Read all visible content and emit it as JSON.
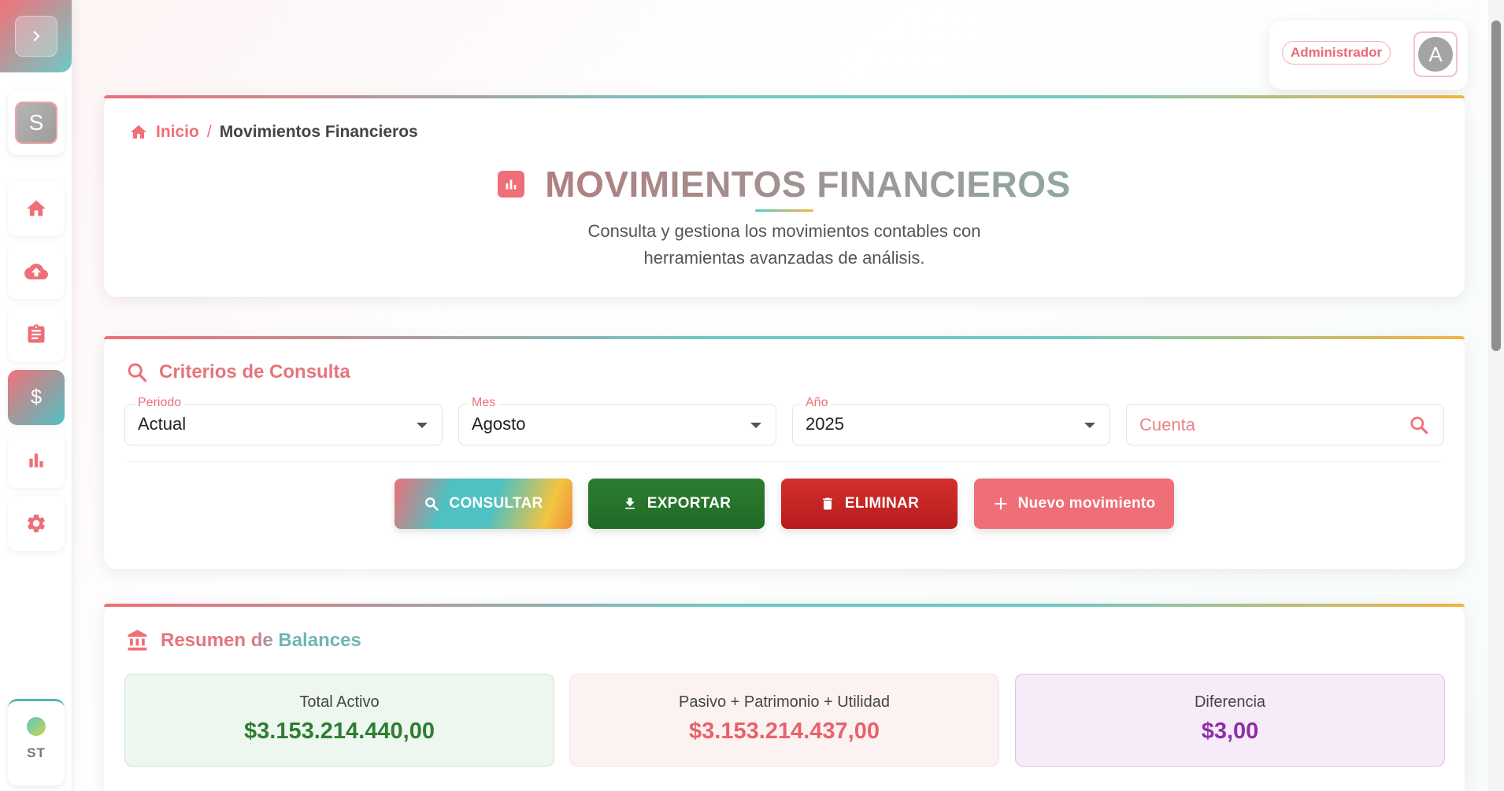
{
  "sidebar": {
    "avatar_letter": "S",
    "footer_label": "ST",
    "items": [
      {
        "name": "home",
        "icon": "home-icon"
      },
      {
        "name": "upload",
        "icon": "cloud-upload-icon"
      },
      {
        "name": "assignment",
        "icon": "clipboard-icon"
      },
      {
        "name": "finance",
        "icon": "dollar-icon",
        "active": true
      },
      {
        "name": "reports",
        "icon": "bar-chart-icon"
      },
      {
        "name": "settings",
        "icon": "gear-icon"
      }
    ]
  },
  "user": {
    "role": "Administrador",
    "avatar_letter": "A"
  },
  "header": {
    "breadcrumb_home": "Inicio",
    "breadcrumb_separator": "/",
    "breadcrumb_current": "Movimientos Financieros",
    "title": "MOVIMIENTOS FINANCIEROS",
    "subtitle": "Consulta y gestiona los movimientos contables con herramientas avanzadas de análisis."
  },
  "criteria": {
    "title": "Criterios de Consulta",
    "periodo": {
      "label": "Periodo",
      "value": "Actual"
    },
    "mes": {
      "label": "Mes",
      "value": "Agosto"
    },
    "anio": {
      "label": "Año",
      "value": "2025"
    },
    "cuenta": {
      "placeholder": "Cuenta",
      "value": ""
    },
    "buttons": {
      "consultar": "CONSULTAR",
      "exportar": "EXPORTAR",
      "eliminar": "ELIMINAR",
      "nuevo": "Nuevo movimiento"
    }
  },
  "balances": {
    "title": "Resumen de Balances",
    "total_activo": {
      "label": "Total Activo",
      "value": "$3.153.214.440,00"
    },
    "pasivo_patrimonio": {
      "label": "Pasivo + Patrimonio + Utilidad",
      "value": "$3.153.214.437,00"
    },
    "diferencia": {
      "label": "Diferencia",
      "value": "$3,00"
    }
  },
  "colors": {
    "accent": "#ef6f78",
    "teal": "#4fc1c2",
    "success": "#2e7d32",
    "danger": "#d32f2f",
    "purple": "#8e2ea7"
  }
}
